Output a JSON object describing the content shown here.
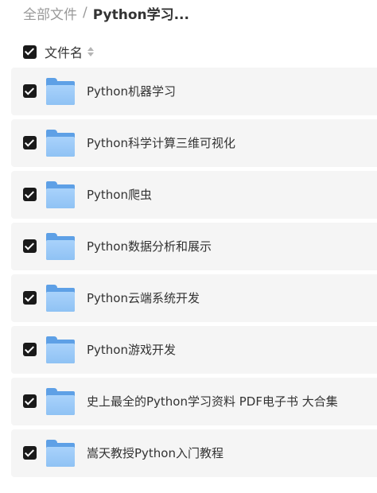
{
  "breadcrumb": {
    "root": "全部文件",
    "separator": "/",
    "current": "Python学习..."
  },
  "list_header": {
    "label": "文件名",
    "sort_icon": "sort-icon"
  },
  "files": [
    {
      "name": "Python机器学习",
      "icon": "folder-icon",
      "checked": true
    },
    {
      "name": "Python科学计算三维可视化",
      "icon": "folder-icon",
      "checked": true
    },
    {
      "name": "Python爬虫",
      "icon": "folder-icon",
      "checked": true
    },
    {
      "name": "Python数据分析和展示",
      "icon": "folder-icon",
      "checked": true
    },
    {
      "name": "Python云端系统开发",
      "icon": "folder-icon",
      "checked": true
    },
    {
      "name": "Python游戏开发",
      "icon": "folder-icon",
      "checked": true
    },
    {
      "name": "史上最全的Python学习资料 PDF电子书 大合集",
      "icon": "folder-icon",
      "checked": true
    },
    {
      "name": "嵩天教授Python入门教程",
      "icon": "folder-icon",
      "checked": true
    }
  ],
  "colors": {
    "row_background": "#f5f5f5",
    "checkbox": "#1a1a1a",
    "folder_blue": "#8fc2f4",
    "muted_text": "#999999"
  }
}
